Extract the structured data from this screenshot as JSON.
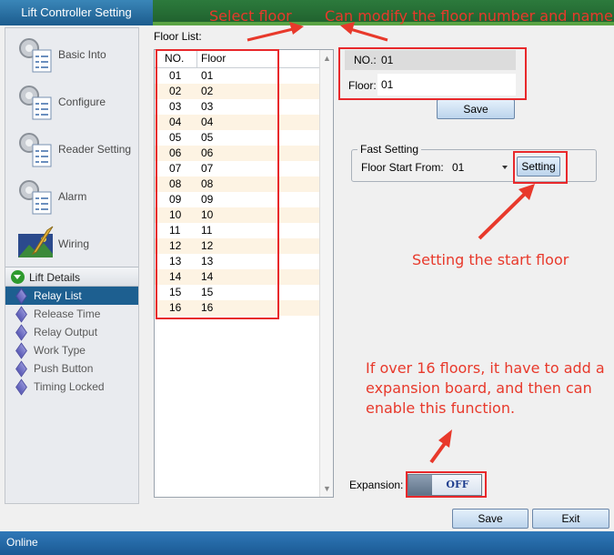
{
  "window": {
    "title": "Lift Controller Setting"
  },
  "sidebar": {
    "buttons": [
      {
        "label": "Basic Into",
        "icon": "gear-checklist-icon"
      },
      {
        "label": "Configure",
        "icon": "gear-checklist-icon"
      },
      {
        "label": "Reader Setting",
        "icon": "gear-checklist-icon"
      },
      {
        "label": "Alarm",
        "icon": "gear-checklist-icon"
      },
      {
        "label": "Wiring",
        "icon": "landscape-pen-icon"
      }
    ],
    "section": {
      "label": "Lift Details",
      "icon": "expand-down-icon"
    },
    "items": [
      {
        "label": "Relay List",
        "active": true
      },
      {
        "label": "Release Time",
        "active": false
      },
      {
        "label": "Relay Output",
        "active": false
      },
      {
        "label": "Work Type",
        "active": false
      },
      {
        "label": "Push Button",
        "active": false
      },
      {
        "label": "Timing Locked",
        "active": false
      }
    ]
  },
  "floor_list": {
    "label": "Floor List:",
    "columns": [
      "NO.",
      "Floor"
    ],
    "rows": [
      [
        "01",
        "01"
      ],
      [
        "02",
        "02"
      ],
      [
        "03",
        "03"
      ],
      [
        "04",
        "04"
      ],
      [
        "05",
        "05"
      ],
      [
        "06",
        "06"
      ],
      [
        "07",
        "07"
      ],
      [
        "08",
        "08"
      ],
      [
        "09",
        "09"
      ],
      [
        "10",
        "10"
      ],
      [
        "11",
        "11"
      ],
      [
        "12",
        "12"
      ],
      [
        "13",
        "13"
      ],
      [
        "14",
        "14"
      ],
      [
        "15",
        "15"
      ],
      [
        "16",
        "16"
      ]
    ]
  },
  "editor": {
    "no_label": "NO.:",
    "no_value": "01",
    "floor_label": "Floor:",
    "floor_value": "01",
    "save_label": "Save"
  },
  "fast_setting": {
    "legend": "Fast Setting",
    "start_label": "Floor Start From:",
    "start_value": "01",
    "button_label": "Setting"
  },
  "expansion": {
    "label": "Expansion:",
    "state": "OFF"
  },
  "footer": {
    "save_label": "Save",
    "exit_label": "Exit"
  },
  "status": {
    "text": "Online"
  },
  "annotations": {
    "select_floor": "Select floor",
    "modify": "Can modify the floor number and name",
    "start_floor": "Setting the start floor",
    "expansion_note": "If over 16 floors, it have to add a expansion board, and then can enable this function.",
    "color": "#e8392b"
  }
}
